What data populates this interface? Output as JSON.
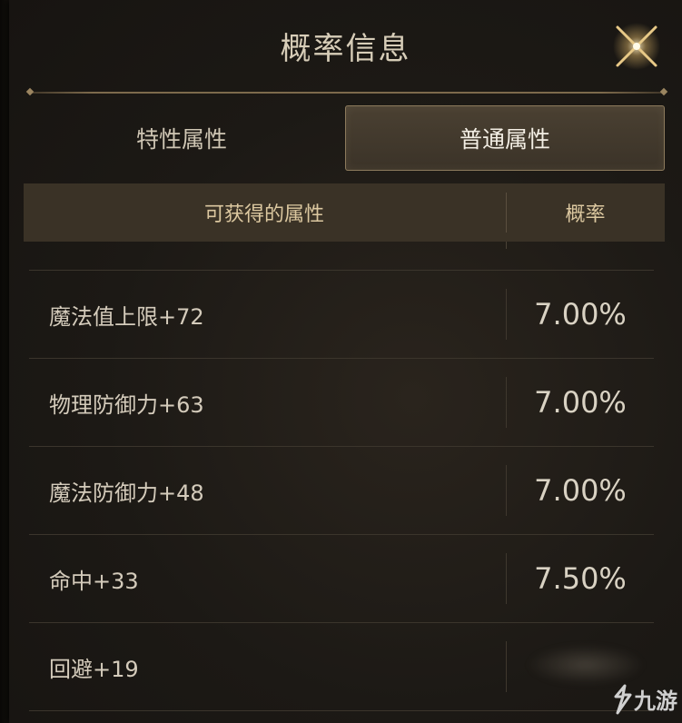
{
  "dialog": {
    "title": "概率信息"
  },
  "tabs": [
    {
      "label": "特性属性",
      "active": false
    },
    {
      "label": "普通属性",
      "active": true
    }
  ],
  "table": {
    "headers": {
      "attribute": "可获得的属性",
      "rate": "概率"
    },
    "rows": [
      {
        "attribute": "魔法值上限+72",
        "rate": "7.00%"
      },
      {
        "attribute": "物理防御力+63",
        "rate": "7.00%"
      },
      {
        "attribute": "魔法防御力+48",
        "rate": "7.00%"
      },
      {
        "attribute": "命中+33",
        "rate": "7.50%"
      },
      {
        "attribute": "回避+19",
        "rate": ""
      }
    ]
  },
  "watermark": {
    "text": "九游"
  },
  "colors": {
    "accent_gold": "#8c7a5c",
    "header_bg": "#3a3226",
    "active_tab_bg": "#4a4032"
  }
}
